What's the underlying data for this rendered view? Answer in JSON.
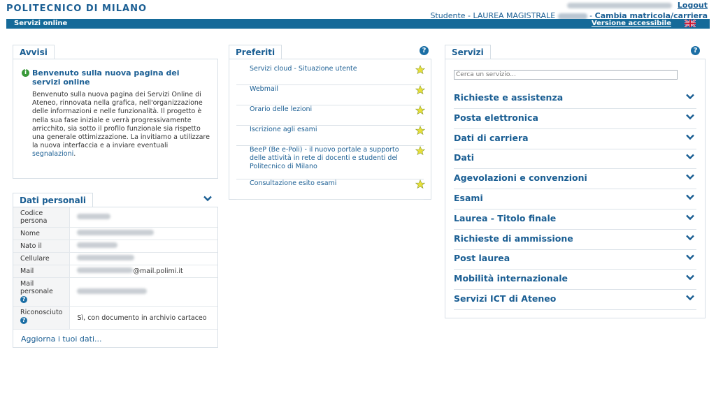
{
  "header": {
    "brand": "POLITECNICO DI MILANO",
    "logout": "Logout",
    "user_prefix": "Studente - LAUREA MAGISTRALE",
    "separator": "-",
    "change_link": "Cambia matricola/carriera"
  },
  "nav": {
    "title": "Servizi online",
    "accessible": "Versione accessibile",
    "flag_icon": "uk-flag-icon"
  },
  "avvisi": {
    "tab": "Avvisi",
    "title": "Benvenuto sulla nuova pagina dei servizi online",
    "body": "Benvenuto sulla nuova pagina dei Servizi Online di Ateneo, rinnovata nella grafica, nell'organizzazione delle informazioni e nelle funzionalità. Il progetto è nella sua fase iniziale e verrà progressivamente arricchito, sia sotto il profilo funzionale sia rispetto una generale ottimizzazione. La invitiamo a utilizzare la nuova interfaccia e a inviare eventuali ",
    "link": "segnalazioni",
    "end": "."
  },
  "dati_personali": {
    "tab": "Dati personali",
    "rows": [
      {
        "key": "Codice persona"
      },
      {
        "key": "Nome"
      },
      {
        "key": "Nato il"
      },
      {
        "key": "Cellulare"
      },
      {
        "key": "Mail",
        "value_suffix": "@mail.polimi.it"
      },
      {
        "key": "Mail personale"
      },
      {
        "key": "Riconosciuto",
        "value": "Sì, con documento in archivio cartaceo"
      }
    ],
    "update_link": "Aggiorna i tuoi dati..."
  },
  "preferiti": {
    "tab": "Preferiti",
    "items": [
      "Servizi cloud - Situazione utente",
      "Webmail",
      "Orario delle lezioni",
      "Iscrizione agli esami",
      "BeeP (Be e-Poli) - il nuovo portale a supporto delle attività in rete di docenti e studenti del Politecnico di Milano",
      "Consultazione esito esami"
    ]
  },
  "servizi": {
    "tab": "Servizi",
    "search_placeholder": "Cerca un servizio...",
    "items": [
      "Richieste e assistenza",
      "Posta elettronica",
      "Dati di carriera",
      "Dati",
      "Agevolazioni e convenzioni",
      "Esami",
      "Laurea - Titolo finale",
      "Richieste di ammissione",
      "Post laurea",
      "Mobilità internazionale",
      "Servizi ICT di Ateneo"
    ]
  },
  "colors": {
    "accent": "#1a5e93",
    "nav_bar": "#156a99",
    "star": "#e8e03a",
    "info": "#3a9a3a"
  }
}
